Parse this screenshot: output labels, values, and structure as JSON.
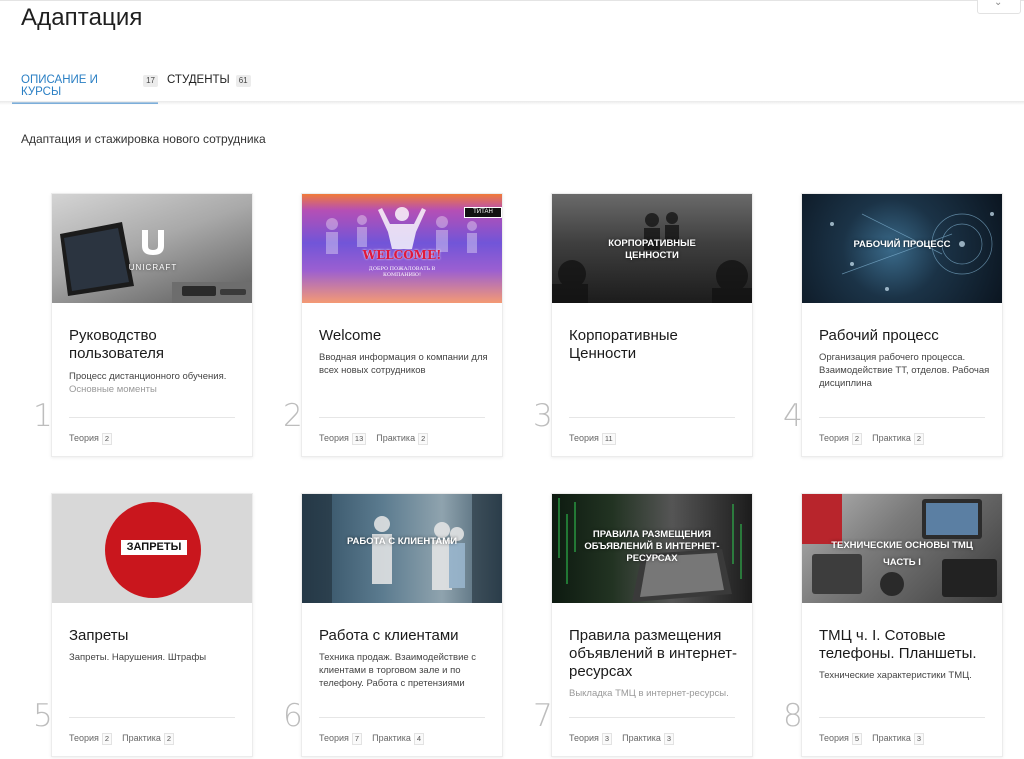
{
  "page": {
    "title": "Адаптация",
    "description": "Адаптация и стажировка нового сотрудника"
  },
  "tabs": [
    {
      "label": "Описание и курсы",
      "count": "17",
      "active": true
    },
    {
      "label": "Студенты",
      "count": "61",
      "active": false
    }
  ],
  "courses": [
    {
      "number": "1",
      "title": "Руководство пользователя",
      "desc": "Процесс дистанционного обучения.",
      "desc_faded": "Основные моменты",
      "thumb_text": "UNICRAFT",
      "tags": [
        {
          "label": "Теория",
          "count": "2"
        }
      ]
    },
    {
      "number": "2",
      "title": "Welcome",
      "desc": "Вводная информация о компании для всех новых сотрудников",
      "desc_faded": "",
      "thumb_text": "WELCOME!",
      "thumb_subtext": "ДОБРО ПОЖАЛОВАТЬ В КОМПАНИЮ!",
      "thumb_logo": "ТИТАН",
      "tags": [
        {
          "label": "Теория",
          "count": "13"
        },
        {
          "label": "Практика",
          "count": "2"
        }
      ]
    },
    {
      "number": "3",
      "title": "Корпоративные Ценности",
      "desc": "",
      "desc_faded": "",
      "thumb_text": "КОРПОРАТИВНЫЕ ЦЕННОСТИ",
      "tags": [
        {
          "label": "Теория",
          "count": "11"
        }
      ]
    },
    {
      "number": "4",
      "title": "Рабочий процесс",
      "desc": "Организация рабочего процесса. Взаимодействие ТТ, отделов. Рабочая дисциплина",
      "desc_faded": "",
      "thumb_text": "РАБОЧИЙ ПРОЦЕСС",
      "tags": [
        {
          "label": "Теория",
          "count": "2"
        },
        {
          "label": "Практика",
          "count": "2"
        }
      ]
    },
    {
      "number": "5",
      "title": "Запреты",
      "desc": "Запреты. Нарушения. Штрафы",
      "desc_faded": "",
      "thumb_text": "ЗАПРЕТЫ",
      "tags": [
        {
          "label": "Теория",
          "count": "2"
        },
        {
          "label": "Практика",
          "count": "2"
        }
      ]
    },
    {
      "number": "6",
      "title": "Работа с клиентами",
      "desc": "Техника продаж. Взаимодействие с клиентами в торговом зале и по телефону. Работа с претензиями",
      "desc_faded": "",
      "thumb_text": "РАБОТА С КЛИЕНТАМИ",
      "tags": [
        {
          "label": "Теория",
          "count": "7"
        },
        {
          "label": "Практика",
          "count": "4"
        }
      ]
    },
    {
      "number": "7",
      "title": "Правила размещения объявлений в интернет-ресурсах",
      "desc": "",
      "desc_faded": "Выкладка ТМЦ в интернет-ресурсы.",
      "thumb_text": "ПРАВИЛА РАЗМЕЩЕНИЯ ОБЪЯВЛЕНИЙ В ИНТЕРНЕТ-РЕСУРСАХ",
      "tags": [
        {
          "label": "Теория",
          "count": "3"
        },
        {
          "label": "Практика",
          "count": "3"
        }
      ]
    },
    {
      "number": "8",
      "title": "ТМЦ ч. I. Сотовые телефоны. Планшеты.",
      "desc": "Технические характеристики ТМЦ.",
      "desc_faded": "",
      "thumb_text": "ТЕХНИЧЕСКИЕ ОСНОВЫ ТМЦ",
      "thumb_subtext": "ЧАСТЬ I",
      "tags": [
        {
          "label": "Теория",
          "count": "5"
        },
        {
          "label": "Практика",
          "count": "3"
        }
      ]
    }
  ],
  "colors": {
    "accent": "#2a7fc4",
    "zaprety_red": "#c9161d"
  }
}
